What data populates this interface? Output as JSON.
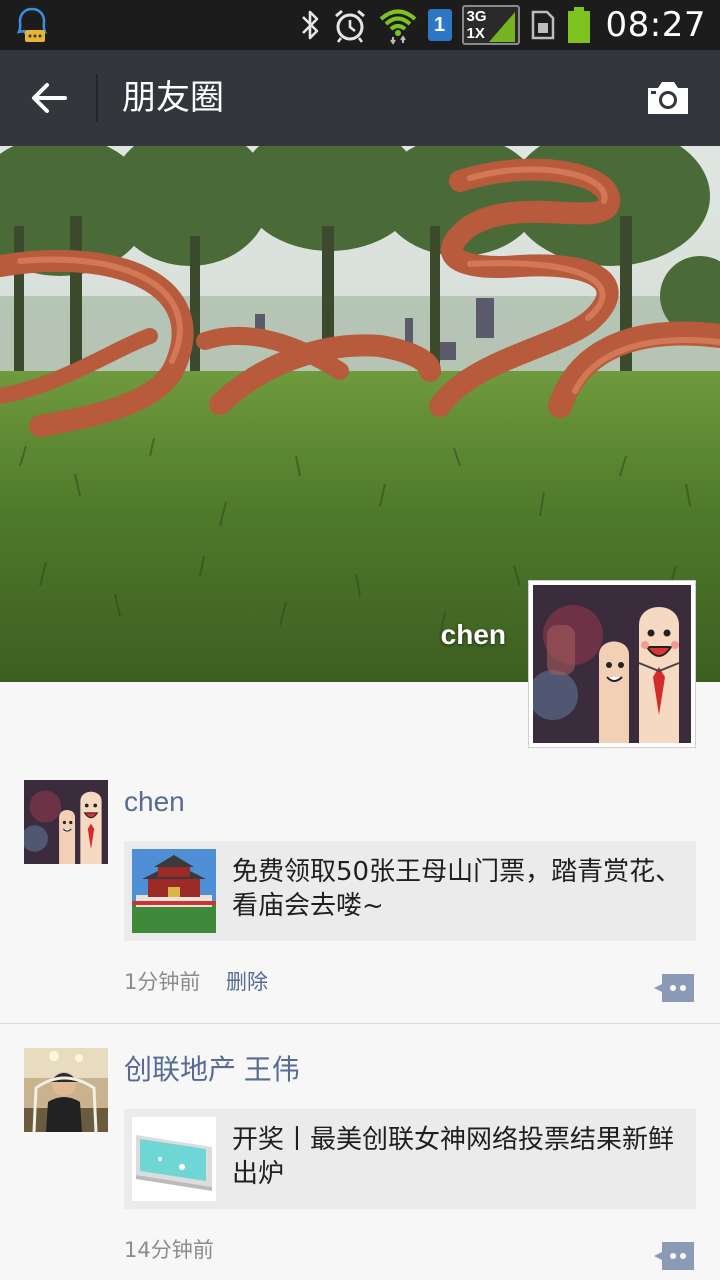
{
  "status_bar": {
    "time": "08:27",
    "sim_slot": "1",
    "network_top": "3G",
    "network_bottom": "1X",
    "icons": [
      "qq-chat-icon",
      "bluetooth-icon",
      "alarm-icon",
      "wifi-icon",
      "sim-icon",
      "network-signal-icon",
      "sd-card-icon",
      "battery-icon"
    ]
  },
  "title_bar": {
    "title": "朋友圈",
    "back_icon": "back-arrow-icon",
    "camera_icon": "camera-icon"
  },
  "cover": {
    "user_name": "chen"
  },
  "posts": [
    {
      "author": "chen",
      "link_text": "免费领取50张王母山门票，踏青赏花、看庙会去喽~",
      "time": "1分钟前",
      "delete_label": "删除"
    },
    {
      "author": "创联地产 王伟",
      "link_text": "开奖丨最美创联女神网络投票结果新鲜出炉",
      "time": "14分钟前"
    }
  ],
  "colors": {
    "title_bar": "#33373c",
    "status_bar": "#1c1c1c",
    "name_link": "#576b95",
    "background": "#f7f7f7"
  }
}
